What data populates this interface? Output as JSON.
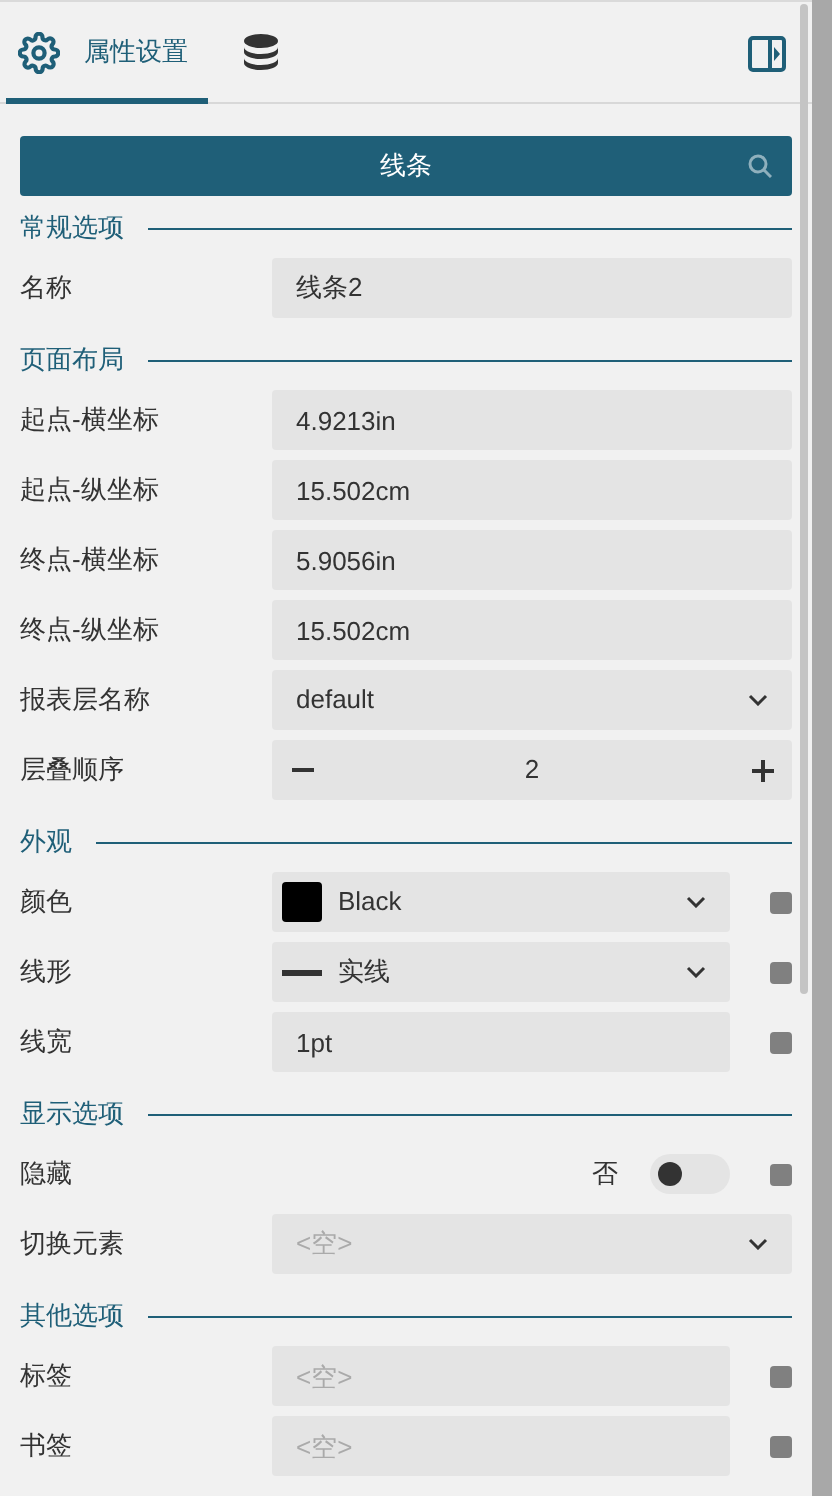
{
  "tabs": [
    {
      "label": "属性设置",
      "selected": true
    },
    {
      "selected": false
    }
  ],
  "search_bar": {
    "title": "线条"
  },
  "sections": [
    {
      "title": "常规选项",
      "rows": [
        {
          "kind": "text",
          "label": "名称",
          "value": "线条2",
          "reset_button": false
        }
      ]
    },
    {
      "title": "页面布局",
      "rows": [
        {
          "kind": "text",
          "label": "起点-横坐标",
          "value": "4.9213in",
          "reset_button": false
        },
        {
          "kind": "text",
          "label": "起点-纵坐标",
          "value": "15.502cm",
          "reset_button": false
        },
        {
          "kind": "text",
          "label": "终点-横坐标",
          "value": "5.9056in",
          "reset_button": false
        },
        {
          "kind": "text",
          "label": "终点-纵坐标",
          "value": "15.502cm",
          "reset_button": false
        },
        {
          "kind": "select",
          "label": "报表层名称",
          "value": "default",
          "reset_button": false
        },
        {
          "kind": "stepper",
          "label": "层叠顺序",
          "value": "2",
          "reset_button": false
        }
      ]
    },
    {
      "title": "外观",
      "rows": [
        {
          "kind": "color",
          "label": "颜色",
          "value": "Black",
          "color": "#000000",
          "reset_button": true
        },
        {
          "kind": "linestyle",
          "label": "线形",
          "value": "实线",
          "reset_button": true
        },
        {
          "kind": "text",
          "label": "线宽",
          "value": "1pt",
          "reset_button": true
        }
      ]
    },
    {
      "title": "显示选项",
      "rows": [
        {
          "kind": "toggle",
          "label": "隐藏",
          "value": "否",
          "on": false,
          "reset_button": true
        },
        {
          "kind": "select",
          "label": "切换元素",
          "placeholder": "<空>",
          "reset_button": false
        }
      ]
    },
    {
      "title": "其他选项",
      "rows": [
        {
          "kind": "text",
          "label": "标签",
          "placeholder": "<空>",
          "reset_button": true
        },
        {
          "kind": "text",
          "label": "书签",
          "placeholder": "<空>",
          "reset_button": true
        }
      ]
    }
  ]
}
